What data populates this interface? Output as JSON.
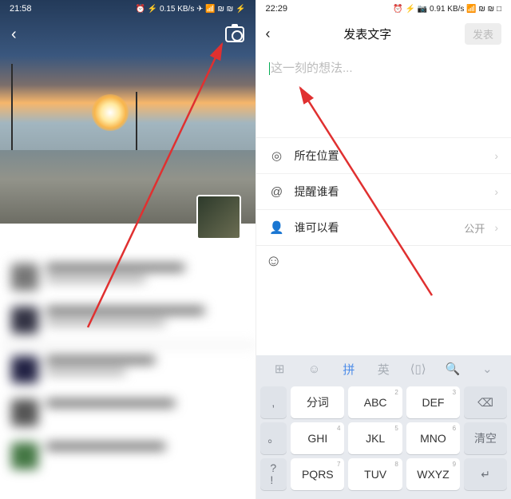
{
  "left": {
    "status_time": "21:58",
    "status_right": "⏰ ⚡ 0.15 KB/s ✈ 📶 ₪ ₪ ⚡"
  },
  "right": {
    "status_time": "22:29",
    "status_right": "⏰ ⚡ 📷 0.91 KB/s 📶 ₪ ₪ □",
    "header": {
      "title": "发表文字",
      "publish": "发表"
    },
    "textarea": {
      "placeholder": "这一刻的想法..."
    },
    "rows": {
      "location": {
        "label": "所在位置"
      },
      "mention": {
        "label": "提醒谁看"
      },
      "visibility": {
        "label": "谁可以看",
        "value": "公开"
      }
    },
    "emoji_icon": "☺",
    "keyboard": {
      "tabs": {
        "grid": "⊞",
        "emoji": "☺",
        "pinyin": "拼",
        "eng": "英",
        "pad": "⟨▯⟩",
        "search": "🔍",
        "down": "⌄"
      },
      "keys": {
        "r1c0": ",",
        "r1c1": "分词",
        "r1c2": "ABC",
        "r1c3": "DEF",
        "r1c4": "⌫",
        "r2c0": "。",
        "r2c1": "GHI",
        "r2c2": "JKL",
        "r2c3": "MNO",
        "r2c4": "清空",
        "r3c0": "?\n!",
        "r3c1": "PQRS",
        "r3c2": "TUV",
        "r3c3": "WXYZ",
        "r3c4": "↵",
        "sup2": "2",
        "sup3": "3",
        "sup4": "4",
        "sup5": "5",
        "sup6": "6",
        "sup7": "7",
        "sup8": "8",
        "sup9": "9"
      }
    }
  }
}
